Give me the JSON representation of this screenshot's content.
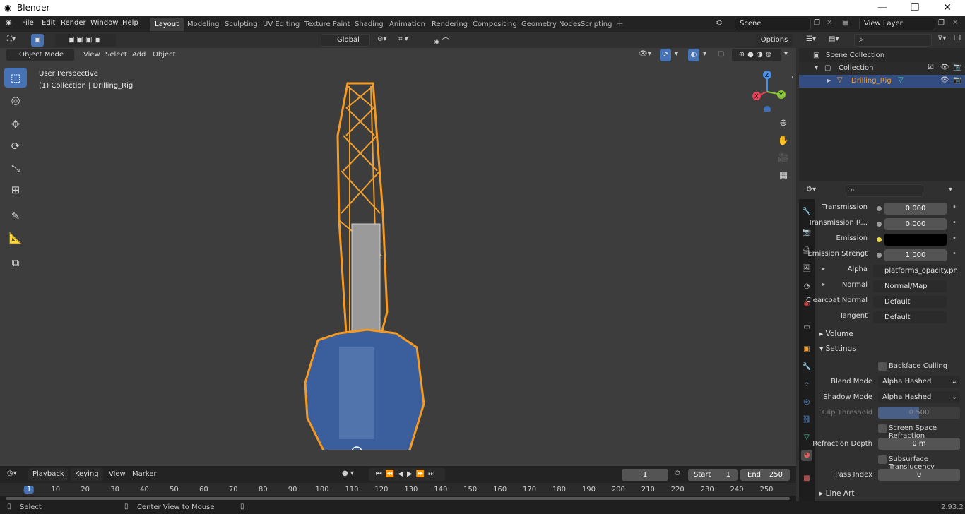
{
  "window": {
    "title": "Blender"
  },
  "menus": [
    "File",
    "Edit",
    "Render",
    "Window",
    "Help"
  ],
  "workspaces": [
    "Layout",
    "Modeling",
    "Sculpting",
    "UV Editing",
    "Texture Paint",
    "Shading",
    "Animation",
    "Rendering",
    "Compositing",
    "Geometry Nodes",
    "Scripting"
  ],
  "active_workspace": "Layout",
  "scene": {
    "name": "Scene",
    "view_layer": "View Layer"
  },
  "viewport": {
    "mode": "Object Mode",
    "menus": [
      "View",
      "Select",
      "Add",
      "Object"
    ],
    "transform_orientation": "Global",
    "options_label": "Options",
    "info_line1": "User Perspective",
    "info_line2": "(1) Collection | Drilling_Rig",
    "gizmo_axes": {
      "x": "X",
      "y": "Y",
      "z": "Z"
    }
  },
  "outliner": {
    "root": "Scene Collection",
    "collection": "Collection",
    "object": "Drilling_Rig"
  },
  "properties": {
    "rows": [
      {
        "label": "Transmission",
        "value": "0.000",
        "type": "num"
      },
      {
        "label": "Transmission R...",
        "value": "0.000",
        "type": "num"
      },
      {
        "label": "Emission",
        "value": "",
        "type": "color"
      },
      {
        "label": "Emission Strengt",
        "value": "1.000",
        "type": "num"
      },
      {
        "label": "Alpha",
        "value": "platforms_opacity.pn",
        "type": "link"
      },
      {
        "label": "Normal",
        "value": "Normal/Map",
        "type": "link"
      },
      {
        "label": "Clearcoat Normal",
        "value": "Default",
        "type": "link"
      },
      {
        "label": "Tangent",
        "value": "Default",
        "type": "link"
      }
    ],
    "sections": {
      "volume": "Volume",
      "settings": "Settings",
      "line_art": "Line Art"
    },
    "settings": {
      "backface_culling": "Backface Culling",
      "blend_mode_label": "Blend Mode",
      "blend_mode": "Alpha Hashed",
      "shadow_mode_label": "Shadow Mode",
      "shadow_mode": "Alpha Hashed",
      "clip_threshold_label": "Clip Threshold",
      "clip_threshold": "0.500",
      "ssr_label": "Screen Space Refraction",
      "refraction_depth_label": "Refraction Depth",
      "refraction_depth": "0 m",
      "sss_label": "Subsurface Translucency",
      "pass_index_label": "Pass Index",
      "pass_index": "0"
    }
  },
  "timeline": {
    "menus": [
      "Playback",
      "Keying",
      "View",
      "Marker"
    ],
    "current_frame": "1",
    "start_label": "Start",
    "start": "1",
    "end_label": "End",
    "end": "250",
    "ticks": [
      "1",
      "10",
      "20",
      "30",
      "40",
      "50",
      "60",
      "70",
      "80",
      "90",
      "100",
      "110",
      "120",
      "130",
      "140",
      "150",
      "160",
      "170",
      "180",
      "190",
      "200",
      "210",
      "220",
      "230",
      "240",
      "250"
    ]
  },
  "status": {
    "select": "Select",
    "center": "Center View to Mouse",
    "version": "2.93.2"
  }
}
